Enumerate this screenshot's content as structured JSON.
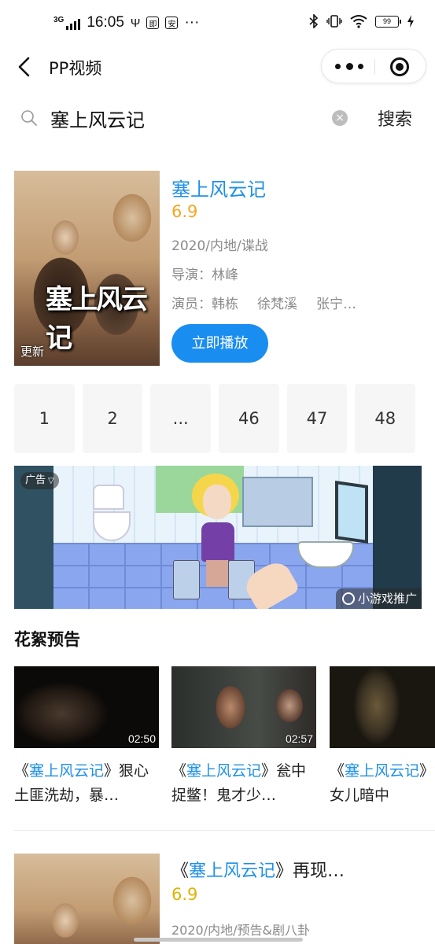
{
  "status_bar": {
    "network": "3G",
    "time": "16:05",
    "icon_a": "Ψ",
    "icon_b": "即",
    "icon_c": "安",
    "more": "···",
    "battery": "99"
  },
  "nav": {
    "title": "PP视频"
  },
  "search": {
    "query": "塞上风云记",
    "button_label": "搜索"
  },
  "main_card": {
    "poster_title": "塞上风云记",
    "poster_badge": "更新",
    "title": "塞上风云记",
    "rating": "6.9",
    "meta": "2020/内地/谍战",
    "director": "导演：林峰",
    "actors_label": "演员：",
    "actors": [
      "韩栋",
      "徐梵溪",
      "张宁…"
    ],
    "play_label": "立即播放"
  },
  "pagination": [
    "1",
    "2",
    "...",
    "46",
    "47",
    "48"
  ],
  "ad": {
    "label": "广告",
    "promo": "小游戏推广"
  },
  "section": {
    "title": "花絮预告"
  },
  "videos": [
    {
      "duration": "02:50",
      "title_prefix": "《",
      "title_hl": "塞上风云记",
      "title_rest": "》狠心土匪洗劫，暴…"
    },
    {
      "duration": "02:57",
      "title_prefix": "《",
      "title_hl": "塞上风云记",
      "title_rest": "》瓮中捉鳖！鬼才少…"
    },
    {
      "duration": "",
      "title_prefix": "《",
      "title_hl": "塞上风云记",
      "title_rest": "》世年女儿暗中"
    }
  ],
  "result2": {
    "title_prefix": "《",
    "title_hl": "塞上风云记",
    "title_rest": "》再现…",
    "rating": "6.9",
    "meta": "2020/内地/预告&剧八卦"
  },
  "colors": {
    "accent": "#1a8df0",
    "link": "#1e90e8",
    "rating": "#f5a623"
  }
}
